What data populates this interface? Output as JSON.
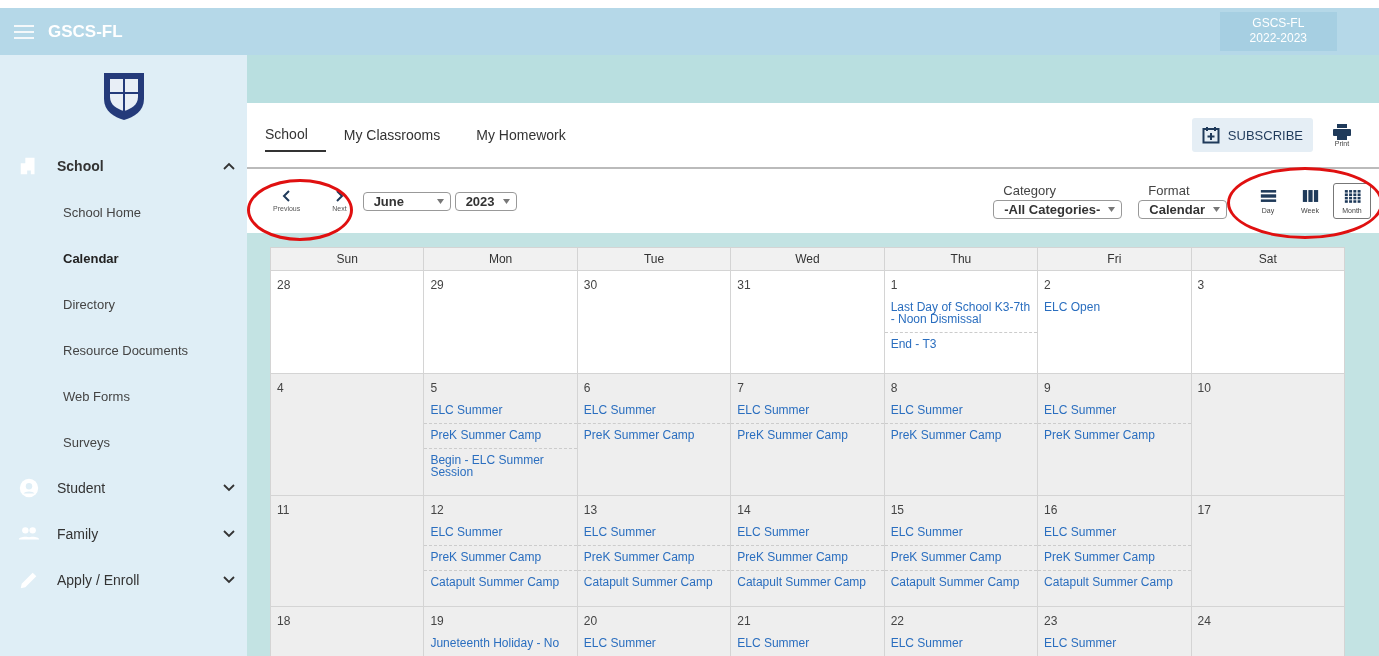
{
  "header": {
    "title": "GSCS-FL",
    "school": "GSCS-FL",
    "year": "2022-2023"
  },
  "sidebar": {
    "items": [
      {
        "label": "School",
        "kind": "building",
        "expanded": true,
        "children": [
          {
            "label": "School Home",
            "selected": false
          },
          {
            "label": "Calendar",
            "selected": true
          },
          {
            "label": "Directory",
            "selected": false
          },
          {
            "label": "Resource Documents",
            "selected": false
          },
          {
            "label": "Web Forms",
            "selected": false
          },
          {
            "label": "Surveys",
            "selected": false
          }
        ]
      },
      {
        "label": "Student",
        "kind": "person",
        "expanded": false
      },
      {
        "label": "Family",
        "kind": "group",
        "expanded": false
      },
      {
        "label": "Apply / Enroll",
        "kind": "pencil",
        "expanded": false
      }
    ]
  },
  "tabs": [
    {
      "label": "School",
      "selected": true
    },
    {
      "label": "My Classrooms",
      "selected": false
    },
    {
      "label": "My Homework",
      "selected": false
    }
  ],
  "subscribe": "SUBSCRIBE",
  "print": "Print",
  "navigation": {
    "circled": true,
    "previous": "Previous",
    "next": "Next",
    "month": "June",
    "year": "2023"
  },
  "category": {
    "label": "Category",
    "value": "-All Categories-"
  },
  "format": {
    "label": "Format",
    "value": "Calendar"
  },
  "views": {
    "circled": true,
    "items": [
      {
        "label": "Day",
        "kind": "day",
        "selected": false
      },
      {
        "label": "Week",
        "kind": "week",
        "selected": false
      },
      {
        "label": "Month",
        "kind": "month",
        "selected": true
      }
    ]
  },
  "calendar": {
    "days": [
      "Sun",
      "Mon",
      "Tue",
      "Wed",
      "Thu",
      "Fri",
      "Sat"
    ],
    "weeks": [
      [
        {
          "date": "28",
          "shaded": false
        },
        {
          "date": "29",
          "shaded": false
        },
        {
          "date": "30",
          "shaded": false
        },
        {
          "date": "31",
          "shaded": false
        },
        {
          "date": "1",
          "shaded": false,
          "events": [
            "Last Day of School K3-7th - Noon Dismissal",
            "End - T3"
          ]
        },
        {
          "date": "2",
          "shaded": false,
          "events": [
            "ELC Open"
          ]
        },
        {
          "date": "3",
          "shaded": false
        }
      ],
      [
        {
          "date": "4",
          "shaded": true
        },
        {
          "date": "5",
          "shaded": true,
          "events": [
            "ELC Summer",
            "PreK Summer Camp",
            "Begin - ELC Summer Session"
          ]
        },
        {
          "date": "6",
          "shaded": true,
          "events": [
            "ELC Summer",
            "PreK Summer Camp"
          ]
        },
        {
          "date": "7",
          "shaded": true,
          "events": [
            "ELC Summer",
            "PreK Summer Camp"
          ]
        },
        {
          "date": "8",
          "shaded": true,
          "events": [
            "ELC Summer",
            "PreK Summer Camp"
          ]
        },
        {
          "date": "9",
          "shaded": true,
          "events": [
            "ELC Summer",
            "PreK Summer Camp"
          ]
        },
        {
          "date": "10",
          "shaded": true
        }
      ],
      [
        {
          "date": "11",
          "shaded": true
        },
        {
          "date": "12",
          "shaded": true,
          "events": [
            "ELC Summer",
            "PreK Summer Camp",
            "Catapult Summer Camp"
          ]
        },
        {
          "date": "13",
          "shaded": true,
          "events": [
            "ELC Summer",
            "PreK Summer Camp",
            "Catapult Summer Camp"
          ]
        },
        {
          "date": "14",
          "shaded": true,
          "events": [
            "ELC Summer",
            "PreK Summer Camp",
            "Catapult Summer Camp"
          ]
        },
        {
          "date": "15",
          "shaded": true,
          "events": [
            "ELC Summer",
            "PreK Summer Camp",
            "Catapult Summer Camp"
          ]
        },
        {
          "date": "16",
          "shaded": true,
          "events": [
            "ELC Summer",
            "PreK Summer Camp",
            "Catapult Summer Camp"
          ]
        },
        {
          "date": "17",
          "shaded": true
        }
      ],
      [
        {
          "date": "18",
          "shaded": true
        },
        {
          "date": "19",
          "shaded": true,
          "events": [
            "Juneteenth Holiday - No"
          ]
        },
        {
          "date": "20",
          "shaded": true,
          "events": [
            "ELC Summer"
          ]
        },
        {
          "date": "21",
          "shaded": true,
          "events": [
            "ELC Summer"
          ]
        },
        {
          "date": "22",
          "shaded": true,
          "events": [
            "ELC Summer"
          ]
        },
        {
          "date": "23",
          "shaded": true,
          "events": [
            "ELC Summer"
          ]
        },
        {
          "date": "24",
          "shaded": true
        }
      ]
    ]
  }
}
